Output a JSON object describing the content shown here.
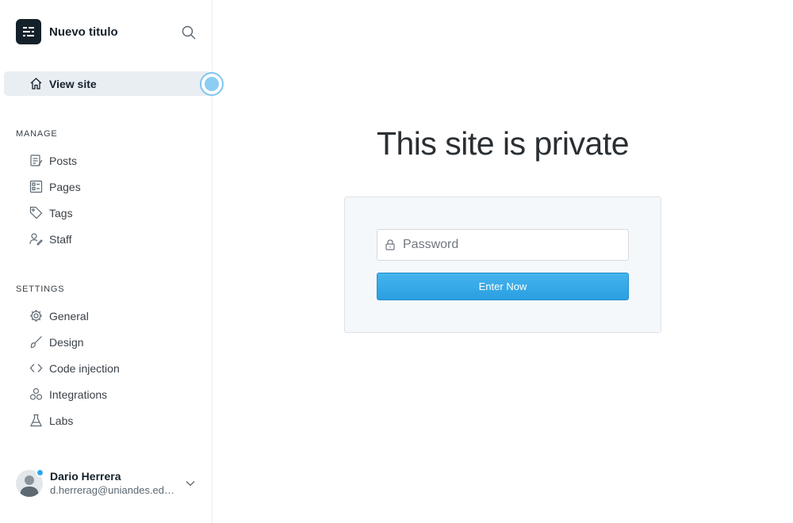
{
  "sidebar": {
    "brand_title": "Nuevo titulo",
    "view_site": "View site",
    "manage_label": "MANAGE",
    "manage_items": [
      {
        "label": "Posts",
        "icon": "posts-icon"
      },
      {
        "label": "Pages",
        "icon": "pages-icon"
      },
      {
        "label": "Tags",
        "icon": "tag-icon"
      },
      {
        "label": "Staff",
        "icon": "staff-icon"
      }
    ],
    "settings_label": "SETTINGS",
    "settings_items": [
      {
        "label": "General",
        "icon": "gear-icon"
      },
      {
        "label": "Design",
        "icon": "brush-icon"
      },
      {
        "label": "Code injection",
        "icon": "code-icon"
      },
      {
        "label": "Integrations",
        "icon": "integrations-icon"
      },
      {
        "label": "Labs",
        "icon": "flask-icon"
      }
    ],
    "user": {
      "name": "Dario Herrera",
      "email": "d.herrerag@uniandes.edu.co"
    }
  },
  "main": {
    "title": "This site is private",
    "password_placeholder": "Password",
    "enter_button": "Enter Now"
  },
  "colors": {
    "accent": "#30a9e8",
    "sidebar_active_bg": "#e9eef3",
    "brand_dark": "#15212a"
  }
}
